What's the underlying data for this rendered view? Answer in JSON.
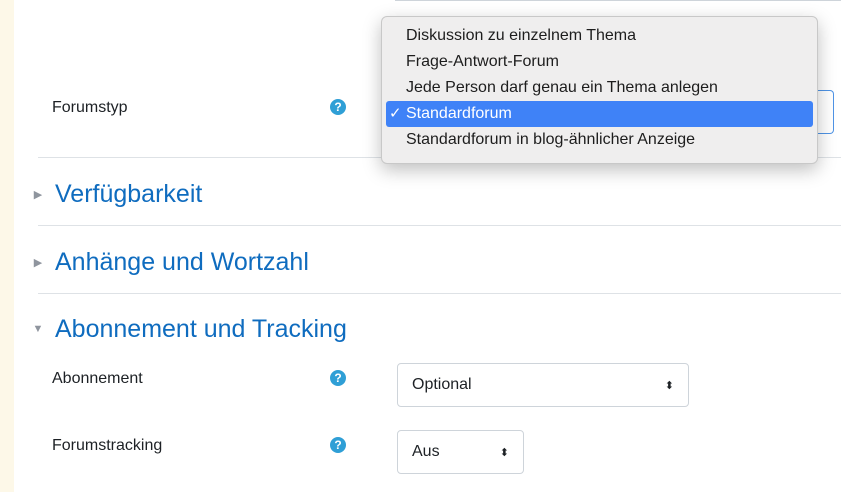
{
  "colors": {
    "accent_link": "#0f6cbf",
    "help_icon": "#2f9fd6",
    "selected_option": "#3f82f7",
    "page_background": "#fdf8e8"
  },
  "form": {
    "forum_type": {
      "label": "Forumstyp",
      "help_icon": "question-circle-icon",
      "dropdown_open": true,
      "selected": "Standardforum",
      "options": [
        "Diskussion zu einzelnem Thema",
        "Frage-Antwort-Forum",
        "Jede Person darf genau ein Thema anlegen",
        "Standardforum",
        "Standardforum in blog-ähnlicher Anzeige"
      ],
      "check_mark": "✓"
    },
    "sections": [
      {
        "title": "Verfügbarkeit",
        "expanded": false,
        "caret": "▶"
      },
      {
        "title": "Anhänge und Wortzahl",
        "expanded": false,
        "caret": "▶"
      },
      {
        "title": "Abonnement und Tracking",
        "expanded": true,
        "caret": "▼"
      }
    ],
    "subscription": {
      "label": "Abonnement",
      "help_icon": "question-circle-icon",
      "value": "Optional",
      "arrows": "⬍"
    },
    "tracking": {
      "label": "Forumstracking",
      "help_icon": "question-circle-icon",
      "value": "Aus",
      "arrows": "⬍"
    },
    "help_glyph": "?"
  }
}
